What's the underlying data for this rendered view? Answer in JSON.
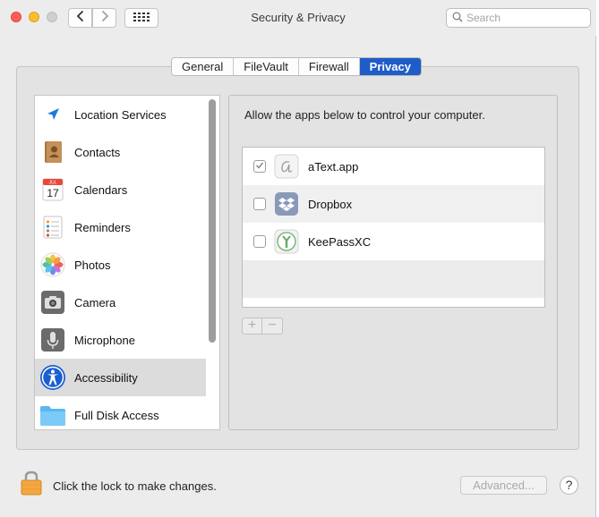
{
  "window": {
    "title": "Security & Privacy",
    "search_placeholder": "Search",
    "nav": {
      "back_glyph": "‹",
      "forward_glyph": "›"
    }
  },
  "tabs": [
    {
      "label": "General",
      "active": false
    },
    {
      "label": "FileVault",
      "active": false
    },
    {
      "label": "Firewall",
      "active": false
    },
    {
      "label": "Privacy",
      "active": true
    }
  ],
  "sidebar": {
    "items": [
      {
        "label": "Location Services",
        "icon": "location-arrow-icon",
        "selected": false
      },
      {
        "label": "Contacts",
        "icon": "contacts-book-icon",
        "selected": false
      },
      {
        "label": "Calendars",
        "icon": "calendar-icon",
        "selected": false
      },
      {
        "label": "Reminders",
        "icon": "reminders-list-icon",
        "selected": false
      },
      {
        "label": "Photos",
        "icon": "photos-flower-icon",
        "selected": false
      },
      {
        "label": "Camera",
        "icon": "camera-icon",
        "selected": false
      },
      {
        "label": "Microphone",
        "icon": "microphone-icon",
        "selected": false
      },
      {
        "label": "Accessibility",
        "icon": "accessibility-person-icon",
        "selected": true
      },
      {
        "label": "Full Disk Access",
        "icon": "folder-icon",
        "selected": false
      }
    ],
    "calendar_icon": {
      "month": "JUL",
      "day": "17"
    }
  },
  "main": {
    "instructions": "Allow the apps below to control your computer.",
    "apps": [
      {
        "name": "aText.app",
        "checked": true,
        "icon": "atext-app-icon"
      },
      {
        "name": "Dropbox",
        "checked": false,
        "icon": "dropbox-icon"
      },
      {
        "name": "KeePassXC",
        "checked": false,
        "icon": "keepassxc-icon"
      }
    ],
    "add_label": "+",
    "remove_label": "−"
  },
  "footer": {
    "lock_text": "Click the lock to make changes.",
    "advanced_label": "Advanced...",
    "help_label": "?"
  },
  "colors": {
    "accent": "#1f5cc8",
    "selected_row": "#dcdcdc",
    "window_bg": "#ececec"
  }
}
